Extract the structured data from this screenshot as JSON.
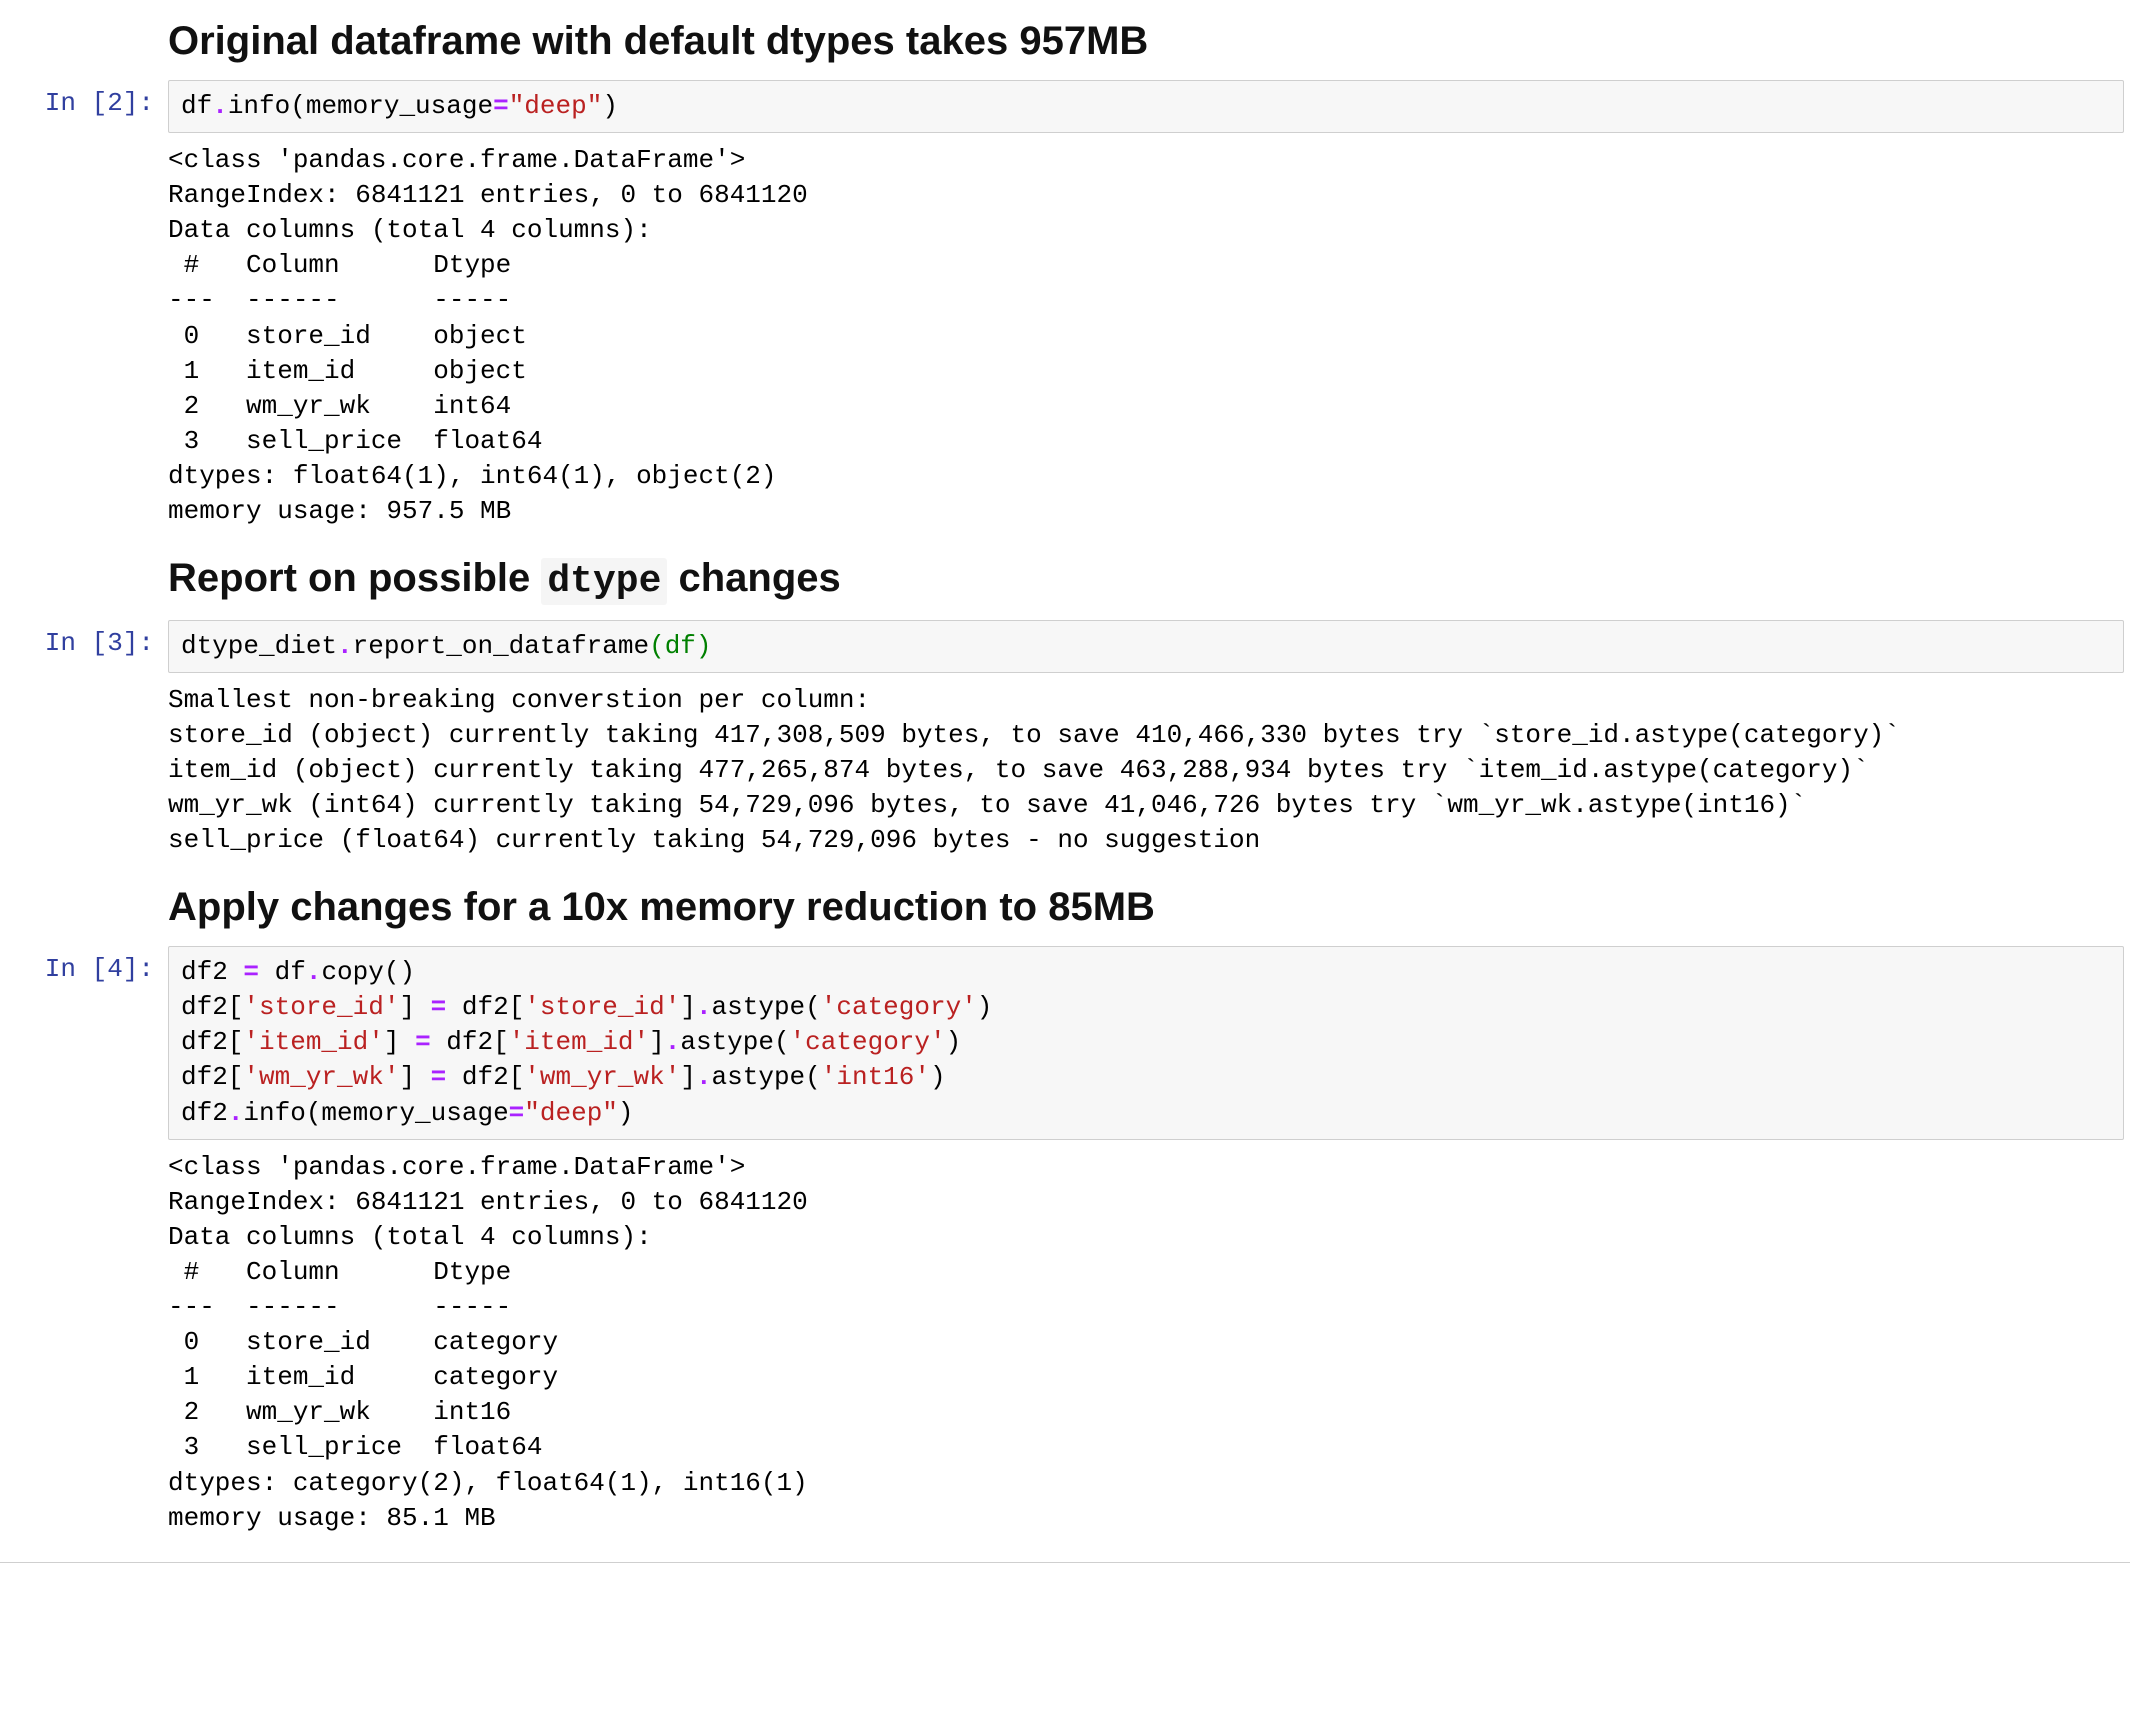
{
  "md1": {
    "heading": "Original dataframe with default dtypes takes 957MB"
  },
  "cell2": {
    "prompt": "In [2]:",
    "code_parts": {
      "a": "df",
      "b": ".",
      "c": "info(memory_usage",
      "d": "=",
      "e": "\"deep\"",
      "f": ")"
    },
    "output": "<class 'pandas.core.frame.DataFrame'>\nRangeIndex: 6841121 entries, 0 to 6841120\nData columns (total 4 columns):\n #   Column      Dtype  \n---  ------      -----  \n 0   store_id    object \n 1   item_id     object \n 2   wm_yr_wk    int64  \n 3   sell_price  float64\ndtypes: float64(1), int64(1), object(2)\nmemory usage: 957.5 MB"
  },
  "md2": {
    "heading_pre": "Report on possible ",
    "heading_code": "dtype",
    "heading_post": " changes"
  },
  "cell3": {
    "prompt": "In [3]:",
    "code_parts": {
      "a": "dtype_diet",
      "b": ".",
      "c": "report_on_dataframe",
      "d": "(df)"
    },
    "output": "Smallest non-breaking converstion per column:\nstore_id (object) currently taking 417,308,509 bytes, to save 410,466,330 bytes try `store_id.astype(category)`\nitem_id (object) currently taking 477,265,874 bytes, to save 463,288,934 bytes try `item_id.astype(category)`\nwm_yr_wk (int64) currently taking 54,729,096 bytes, to save 41,046,726 bytes try `wm_yr_wk.astype(int16)`\nsell_price (float64) currently taking 54,729,096 bytes - no suggestion"
  },
  "md3": {
    "heading": "Apply changes for a 10x memory reduction to 85MB"
  },
  "cell4": {
    "prompt": "In [4]:",
    "code_parts": {
      "l1a": "df2 ",
      "l1b": "=",
      "l1c": " df",
      "l1d": ".",
      "l1e": "copy()",
      "l2a": "df2[",
      "l2b": "'store_id'",
      "l2c": "] ",
      "l2d": "=",
      "l2e": " df2[",
      "l2f": "'store_id'",
      "l2g": "]",
      "l2h": ".",
      "l2i": "astype(",
      "l2j": "'category'",
      "l2k": ")",
      "l3a": "df2[",
      "l3b": "'item_id'",
      "l3c": "] ",
      "l3d": "=",
      "l3e": " df2[",
      "l3f": "'item_id'",
      "l3g": "]",
      "l3h": ".",
      "l3i": "astype(",
      "l3j": "'category'",
      "l3k": ")",
      "l4a": "df2[",
      "l4b": "'wm_yr_wk'",
      "l4c": "] ",
      "l4d": "=",
      "l4e": " df2[",
      "l4f": "'wm_yr_wk'",
      "l4g": "]",
      "l4h": ".",
      "l4i": "astype(",
      "l4j": "'int16'",
      "l4k": ")",
      "l5a": "df2",
      "l5b": ".",
      "l5c": "info(memory_usage",
      "l5d": "=",
      "l5e": "\"deep\"",
      "l5f": ")"
    },
    "output": "<class 'pandas.core.frame.DataFrame'>\nRangeIndex: 6841121 entries, 0 to 6841120\nData columns (total 4 columns):\n #   Column      Dtype   \n---  ------      -----   \n 0   store_id    category\n 1   item_id     category\n 2   wm_yr_wk    int16   \n 3   sell_price  float64 \ndtypes: category(2), float64(1), int16(1)\nmemory usage: 85.1 MB"
  }
}
